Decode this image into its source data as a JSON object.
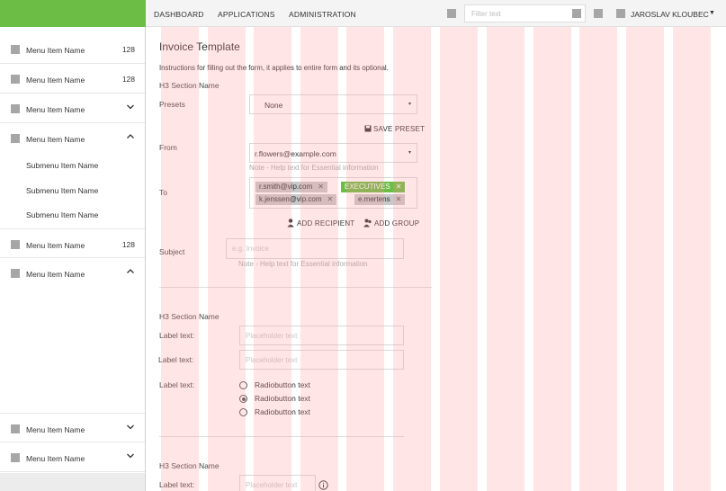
{
  "topbar": {
    "nav": [
      "DASHBOARD",
      "APPLICATIONS",
      "ADMINISTRATION"
    ],
    "filter_placeholder": "Filter text",
    "user_name": "JAROSLAV KLOUBEC",
    "caret": "▼"
  },
  "sidebar": {
    "items": [
      {
        "label": "Menu Item Name",
        "count": "128"
      },
      {
        "label": "Menu Item Name",
        "count": "128"
      },
      {
        "label": "Menu Item Name",
        "chevron": "down"
      },
      {
        "label": "Menu Item Name",
        "chevron": "up"
      },
      {
        "label": "Menu Item Name",
        "count": "128"
      },
      {
        "label": "Menu Item Name",
        "chevron": "up"
      },
      {
        "label": "Menu Item Name",
        "chevron": "down"
      },
      {
        "label": "Menu Item Name",
        "chevron": "down"
      }
    ],
    "subitems": [
      "Submenu Item Name",
      "Submenu Item Name",
      "Submenu Item Name"
    ]
  },
  "form": {
    "title": "Invoice Template",
    "instructions": "Instructions for filling out the form, it applies to entire form and its optional.",
    "h3_1": "H3 Section Name",
    "presets_label": "Presets",
    "presets_value": "None",
    "select_arrow": "▾",
    "save_preset": "SAVE PRESET",
    "from_label": "From",
    "from_value": "r.flowers@example.com",
    "from_note": "Note - Help text for Essential information",
    "to_label": "To",
    "recipients": [
      {
        "text": "r.smith@vip.com",
        "style": "grey"
      },
      {
        "text": "EXECUTIVES",
        "style": "green"
      },
      {
        "text": "k.jenssen@vip.com",
        "style": "grey"
      },
      {
        "text": "e.mertens",
        "style": "grey"
      }
    ],
    "chip_remove": "✕",
    "add_recipient": "ADD RECIPIENT",
    "add_group": "ADD GROUP",
    "subject_label": "Subject",
    "subject_placeholder": "e.g. Invoice",
    "subject_note": "Note - Help text for Essential information",
    "h3_2": "H3 Section Name",
    "label_text": "Label text:",
    "placeholder_text": "Placeholder text",
    "radio_options": [
      "Radiobutton text",
      "Radiobutton text",
      "Radiobutton text"
    ],
    "radio_selected_index": 1,
    "h3_3": "H3 Section Name"
  },
  "colors": {
    "brand": "#6bbd45",
    "grid_overlay": "#ffb3b3"
  }
}
